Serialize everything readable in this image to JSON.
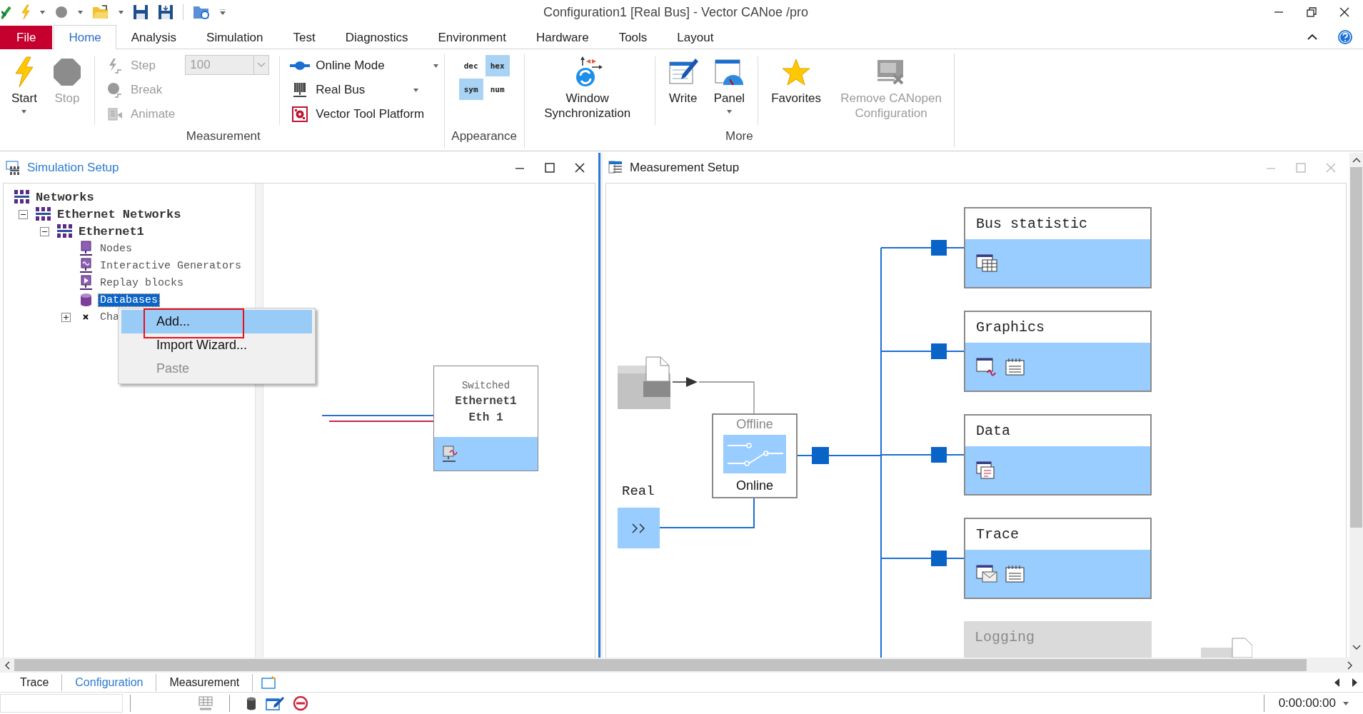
{
  "title_bar": {
    "title": "Configuration1 [Real Bus] - Vector CANoe /pro"
  },
  "menu_tabs": [
    {
      "label": "File",
      "kind": "file",
      "selected": false
    },
    {
      "label": "Home",
      "kind": "tab",
      "selected": true
    },
    {
      "label": "Analysis",
      "kind": "tab",
      "selected": false
    },
    {
      "label": "Simulation",
      "kind": "tab",
      "selected": false
    },
    {
      "label": "Test",
      "kind": "tab",
      "selected": false
    },
    {
      "label": "Diagnostics",
      "kind": "tab",
      "selected": false
    },
    {
      "label": "Environment",
      "kind": "tab",
      "selected": false
    },
    {
      "label": "Hardware",
      "kind": "tab",
      "selected": false
    },
    {
      "label": "Tools",
      "kind": "tab",
      "selected": false
    },
    {
      "label": "Layout",
      "kind": "tab",
      "selected": false
    }
  ],
  "ribbon": {
    "groups": [
      {
        "label": "Measurement",
        "items": [
          {
            "kind": "large",
            "label": "Start",
            "disabled": false,
            "dropdown": true
          },
          {
            "kind": "large",
            "label": "Stop",
            "disabled": true,
            "dropdown": false
          },
          {
            "kind": "separator"
          },
          {
            "kind": "stack",
            "buttons": [
              {
                "label": "Step",
                "disabled": true,
                "dropdown": false
              },
              {
                "label": "Break",
                "disabled": true,
                "dropdown": false
              },
              {
                "label": "Animate",
                "disabled": true,
                "dropdown": false
              }
            ]
          },
          {
            "kind": "combo",
            "value": "100",
            "disabled": true
          },
          {
            "kind": "separator"
          },
          {
            "kind": "stack",
            "buttons": [
              {
                "label": "Online Mode",
                "disabled": false,
                "dropdown": true
              },
              {
                "label": "Real Bus",
                "disabled": false,
                "dropdown": true
              },
              {
                "label": "Vector Tool Platform",
                "disabled": false,
                "dropdown": false
              }
            ]
          }
        ]
      },
      {
        "label": "Appearance",
        "items": [
          {
            "kind": "toggles",
            "options": [
              {
                "label": "dec",
                "selected": false
              },
              {
                "label": "hex",
                "selected": true
              },
              {
                "label": "sym",
                "selected": true
              },
              {
                "label": "num",
                "selected": false
              }
            ]
          }
        ]
      },
      {
        "label": "More",
        "items": [
          {
            "kind": "large",
            "label": "Window Synchronization",
            "disabled": false,
            "dropdown": false
          },
          {
            "kind": "separator"
          },
          {
            "kind": "large",
            "label": "Write",
            "disabled": false,
            "dropdown": false
          },
          {
            "kind": "large",
            "label": "Panel",
            "disabled": false,
            "dropdown": true
          },
          {
            "kind": "separator"
          },
          {
            "kind": "large",
            "label": "Favorites",
            "disabled": false,
            "dropdown": false
          },
          {
            "kind": "large",
            "label": "Remove CANopen Configuration",
            "disabled": true,
            "dropdown": false
          }
        ]
      }
    ]
  },
  "simulation_setup": {
    "title": "Simulation Setup",
    "active": true,
    "tree": [
      {
        "label": "Networks",
        "selected": false,
        "children": [
          {
            "label": "Ethernet Networks",
            "expanded": true,
            "selected": false,
            "children": [
              {
                "label": "Ethernet1",
                "expanded": true,
                "selected": false,
                "children": [
                  {
                    "label": "Nodes",
                    "selected": false
                  },
                  {
                    "label": "Interactive Generators",
                    "selected": false
                  },
                  {
                    "label": "Replay blocks",
                    "selected": false
                  },
                  {
                    "label": "Databases",
                    "selected": true
                  },
                  {
                    "label": "Cha",
                    "expanded": false,
                    "selected": false
                  }
                ]
              }
            ]
          }
        ]
      }
    ],
    "context_menu": {
      "items": [
        {
          "label": "Add...",
          "selected": true,
          "disabled": false,
          "highlighted": true
        },
        {
          "label": "Import Wizard...",
          "selected": false,
          "disabled": false,
          "highlighted": false
        },
        {
          "label": "Paste",
          "selected": false,
          "disabled": true,
          "highlighted": false
        }
      ]
    },
    "node": {
      "type": "Switched",
      "name": "Ethernet1",
      "channel": "Eth 1"
    }
  },
  "measurement_setup": {
    "title": "Measurement Setup",
    "active": false,
    "source": {
      "label": "Real"
    },
    "switch": {
      "options": [
        {
          "label": "Offline",
          "selected": false
        },
        {
          "label": "Online",
          "selected": true
        }
      ]
    },
    "blocks": [
      {
        "title": "Bus statistic",
        "disabled": false
      },
      {
        "title": "Graphics",
        "disabled": false
      },
      {
        "title": "Data",
        "disabled": false
      },
      {
        "title": "Trace",
        "disabled": false
      },
      {
        "title": "Logging",
        "disabled": true
      }
    ]
  },
  "bottom_tabs": [
    {
      "label": "Trace",
      "selected": false
    },
    {
      "label": "Configuration",
      "selected": true
    },
    {
      "label": "Measurement",
      "selected": false
    }
  ],
  "status_bar": {
    "time": "0:00:00:00"
  }
}
